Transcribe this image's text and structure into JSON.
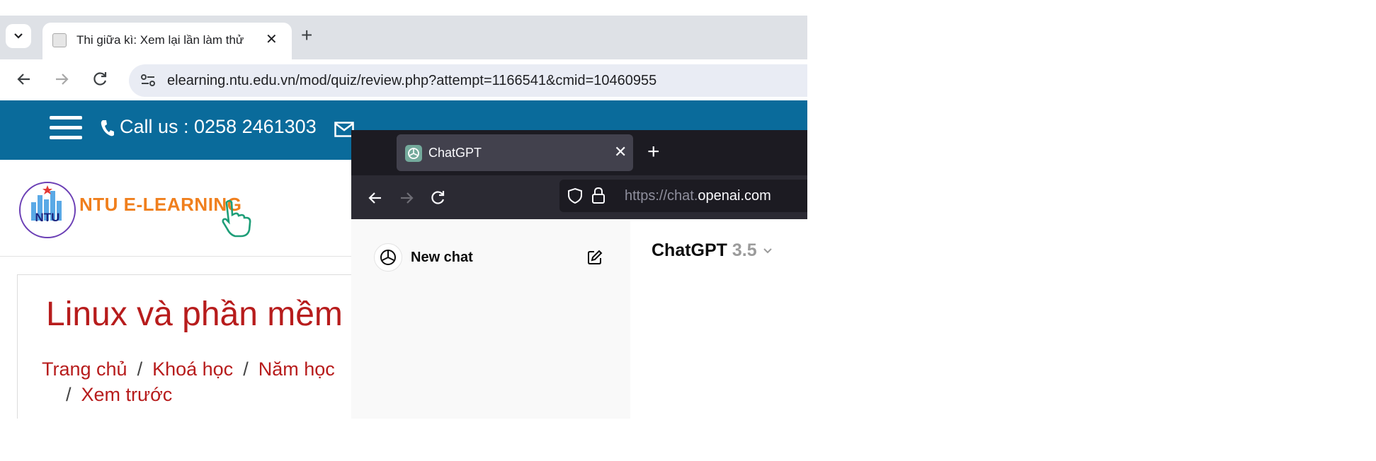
{
  "chrome": {
    "tab_title": "Thi giữa kì: Xem lại lần làm thử",
    "url": "elearning.ntu.edu.vn/mod/quiz/review.php?attempt=1166541&cmid=10460955"
  },
  "page": {
    "call_us": "Call us : 0258 2461303",
    "logo_text": "NTU E-LEARNING",
    "logo_badge": "NTU",
    "course_title": "Linux và phần mềm",
    "breadcrumbs": [
      "Trang chủ",
      "Khoá học",
      "Năm học"
    ],
    "breadcrumb_last": "Xem trước",
    "separator": "/"
  },
  "firefox": {
    "tab_title": "ChatGPT",
    "url_prefix": "https://chat.",
    "url_domain": "openai.com"
  },
  "chatgpt": {
    "new_chat": "New chat",
    "model_name": "ChatGPT",
    "model_version": "3.5"
  },
  "colors": {
    "topbar": "#0a6b9b",
    "link_red": "#b71c1c",
    "logo_orange": "#f07f1d",
    "firefox_dark": "#1c1b22"
  }
}
